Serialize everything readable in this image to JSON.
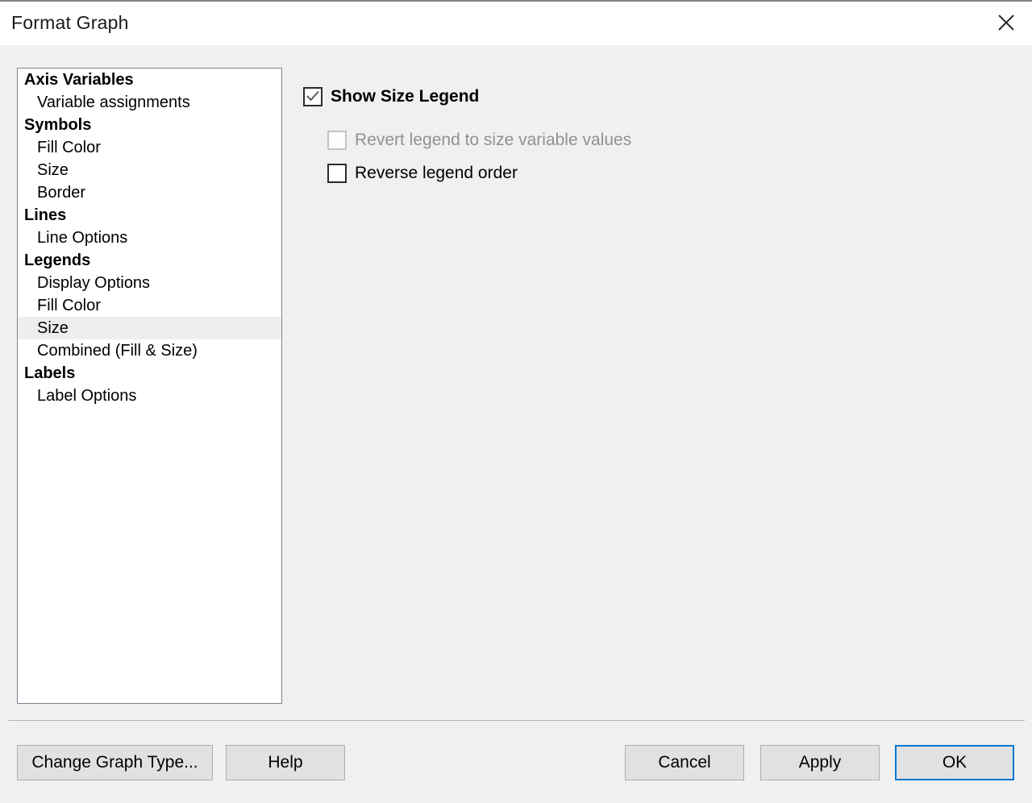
{
  "window": {
    "title": "Format Graph",
    "close_icon": "close-icon"
  },
  "sidebar": {
    "items": [
      {
        "label": "Axis Variables",
        "type": "header",
        "selected": false
      },
      {
        "label": "Variable assignments",
        "type": "child",
        "selected": false
      },
      {
        "label": "Symbols",
        "type": "header",
        "selected": false
      },
      {
        "label": "Fill Color",
        "type": "child",
        "selected": false
      },
      {
        "label": "Size",
        "type": "child",
        "selected": false
      },
      {
        "label": "Border",
        "type": "child",
        "selected": false
      },
      {
        "label": "Lines",
        "type": "header",
        "selected": false
      },
      {
        "label": "Line Options",
        "type": "child",
        "selected": false
      },
      {
        "label": "Legends",
        "type": "header",
        "selected": false
      },
      {
        "label": "Display Options",
        "type": "child",
        "selected": false
      },
      {
        "label": "Fill Color",
        "type": "child",
        "selected": false
      },
      {
        "label": "Size",
        "type": "child",
        "selected": true
      },
      {
        "label": "Combined (Fill & Size)",
        "type": "child",
        "selected": false
      },
      {
        "label": "Labels",
        "type": "header",
        "selected": false
      },
      {
        "label": "Label Options",
        "type": "child",
        "selected": false
      }
    ]
  },
  "options": {
    "show_size_legend": {
      "label": "Show Size Legend",
      "checked": true,
      "disabled": false
    },
    "revert_legend": {
      "label": "Revert legend to size variable values",
      "checked": false,
      "disabled": true
    },
    "reverse_order": {
      "label": "Reverse legend order",
      "checked": false,
      "disabled": false
    }
  },
  "footer": {
    "change_graph_type": "Change Graph Type...",
    "help": "Help",
    "cancel": "Cancel",
    "apply": "Apply",
    "ok": "OK"
  },
  "colors": {
    "accent": "#0078d7",
    "window_bg": "#f0f0f0",
    "titlebar_bg": "#ffffff",
    "listbox_bg": "#ffffff",
    "selection_bg": "#eeeeee",
    "button_bg": "#e1e1e1",
    "disabled_text": "#919191"
  }
}
